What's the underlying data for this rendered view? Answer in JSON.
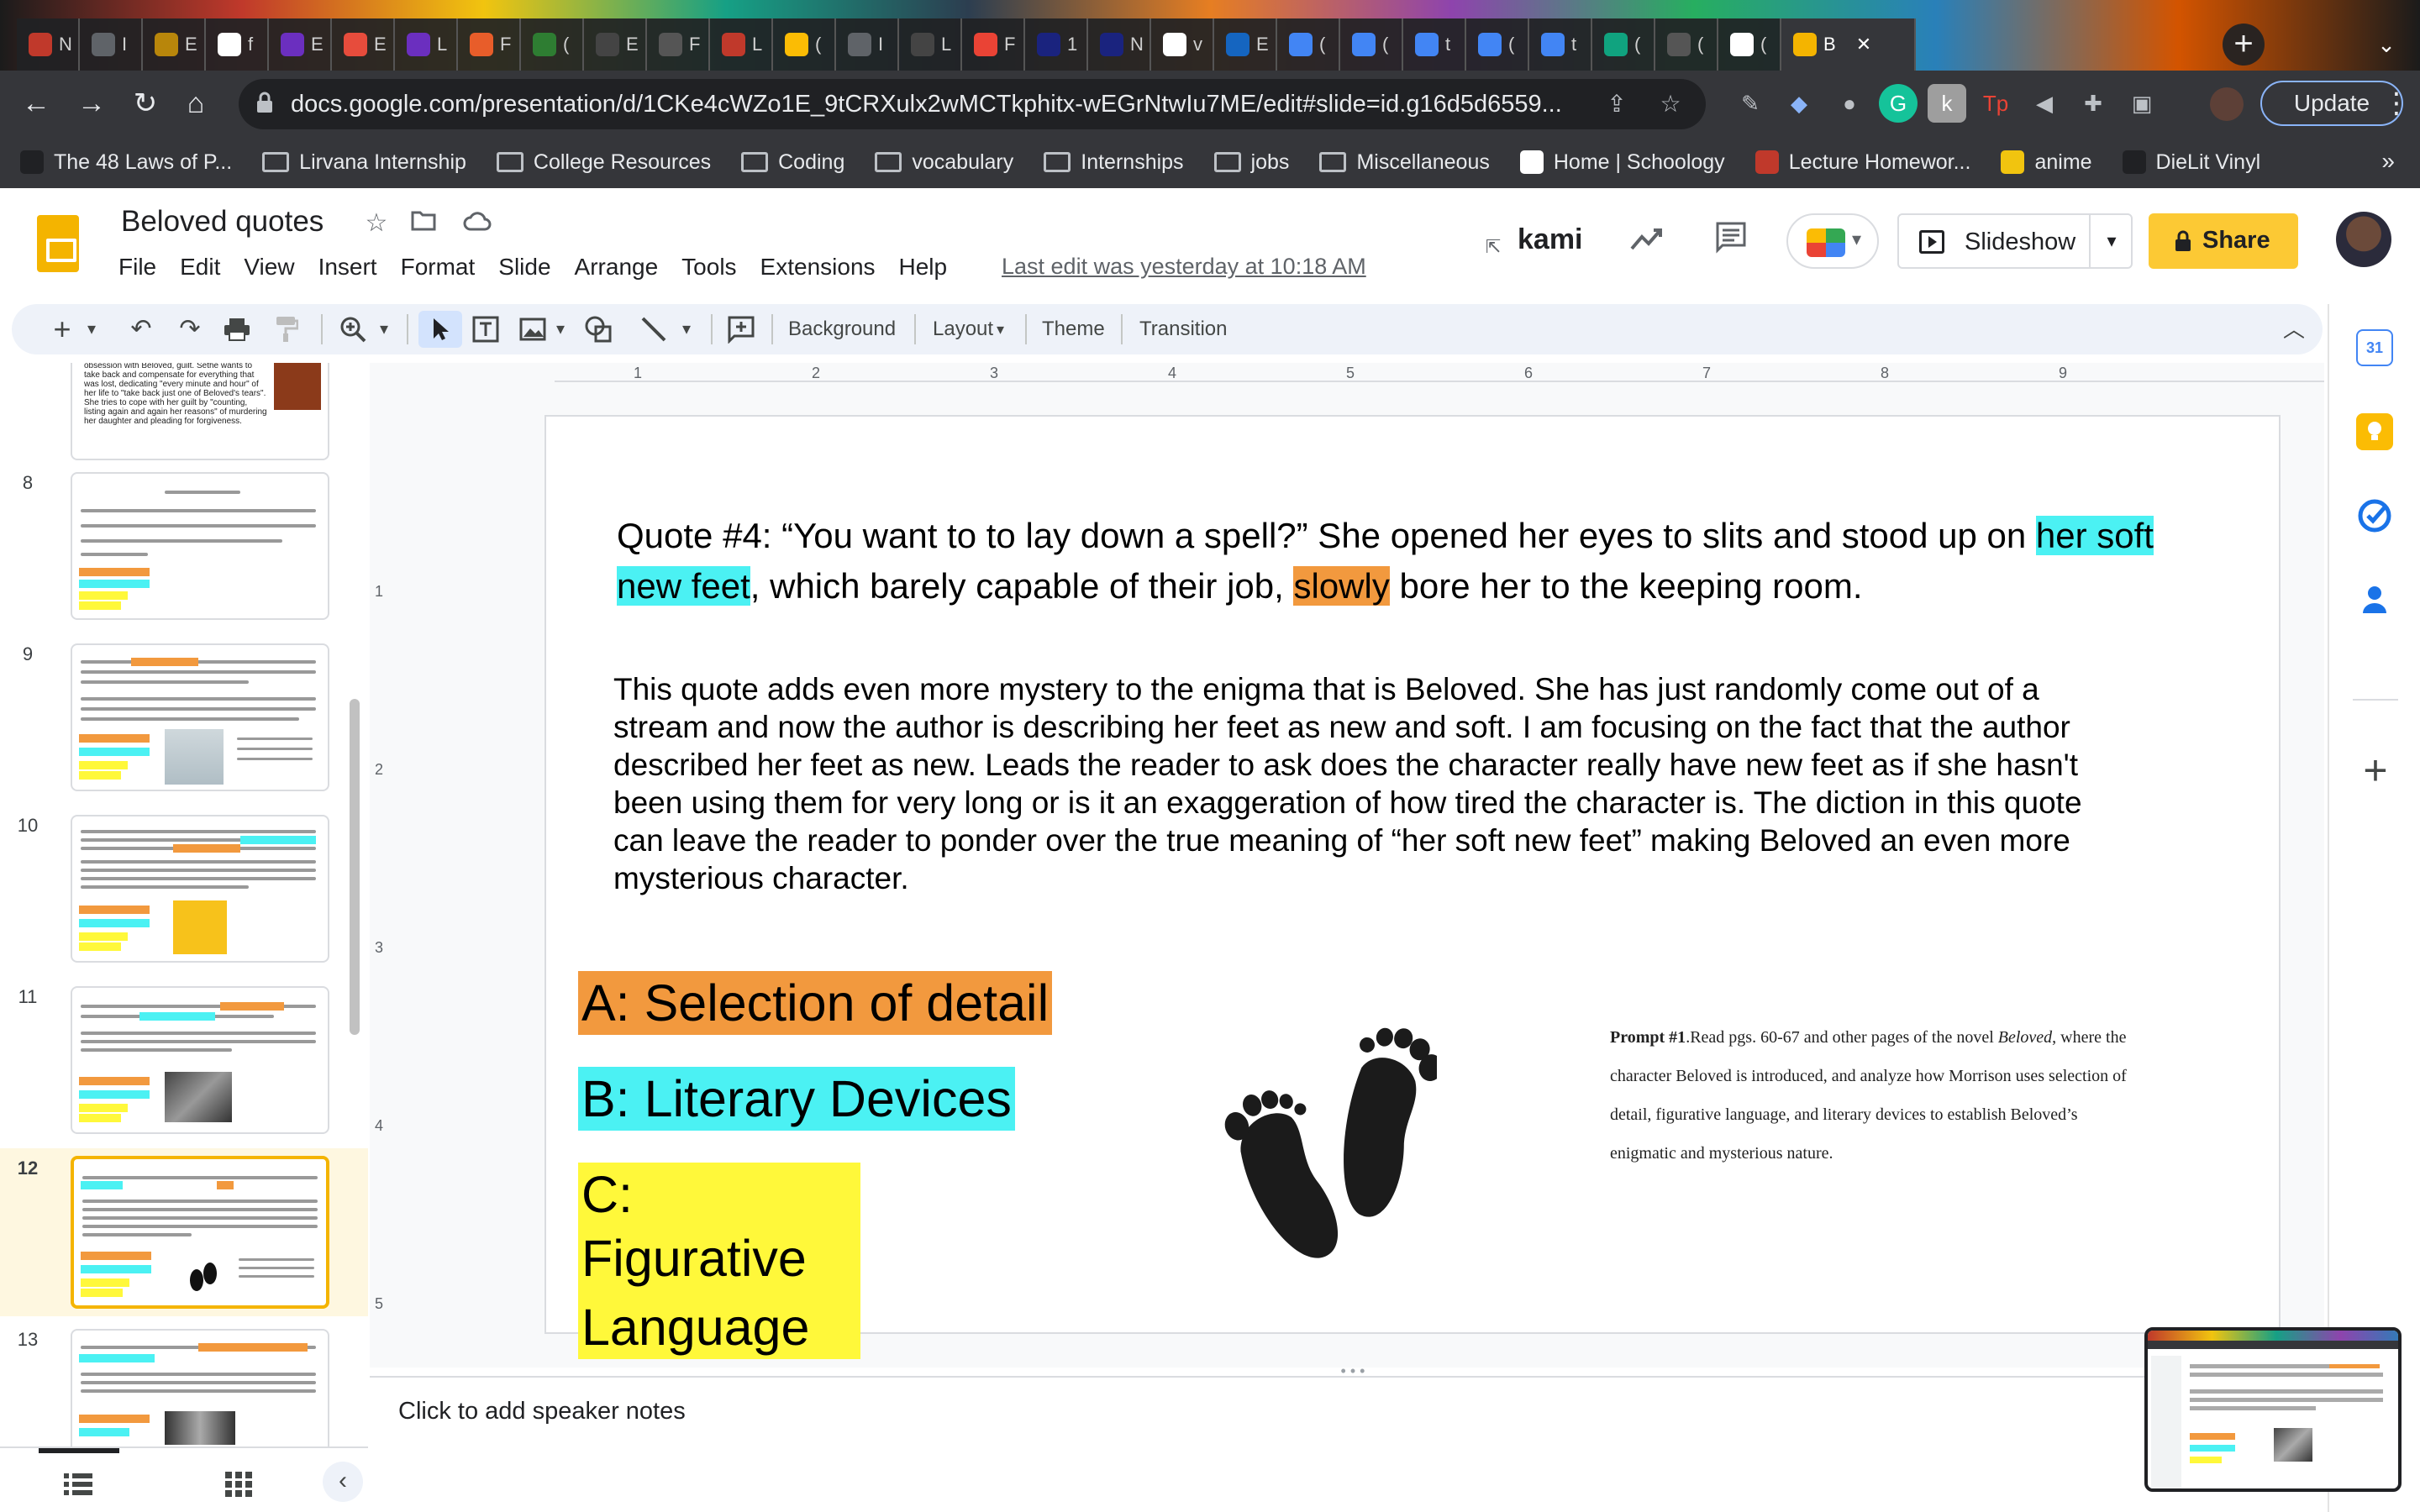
{
  "browser": {
    "tabs": [
      {
        "letter": "N",
        "icon": "generic-red-icon",
        "color": "#c0392b"
      },
      {
        "letter": "I",
        "icon": "globe-icon",
        "color": "#5f6368"
      },
      {
        "letter": "E",
        "icon": "iw-icon",
        "color": "#b8860b"
      },
      {
        "letter": "f",
        "icon": "google-icon",
        "color": "#ffffff"
      },
      {
        "letter": "E",
        "icon": "zb-icon",
        "color": "#6b2fbf"
      },
      {
        "letter": "E",
        "icon": "red-doc-icon",
        "color": "#e74c3c"
      },
      {
        "letter": "L",
        "icon": "zb-icon",
        "color": "#6b2fbf"
      },
      {
        "letter": "F",
        "icon": "asterisk-icon",
        "color": "#e85d2a"
      },
      {
        "letter": "(",
        "icon": "w-icon",
        "color": "#2e7d32"
      },
      {
        "letter": "E",
        "icon": "s-icon",
        "color": "#444444"
      },
      {
        "letter": "F",
        "icon": "feather-icon",
        "color": "#555555"
      },
      {
        "letter": "L",
        "icon": "dotted-circle-icon",
        "color": "#c0392b"
      },
      {
        "letter": "(",
        "icon": "drive-icon",
        "color": "#fbbc04"
      },
      {
        "letter": "I",
        "icon": "globe-icon",
        "color": "#5f6368"
      },
      {
        "letter": "L",
        "icon": "m-icon",
        "color": "#444444"
      },
      {
        "letter": "F",
        "icon": "gmail-icon",
        "color": "#ea4335"
      },
      {
        "letter": "1",
        "icon": "cal-icon",
        "color": "#1a237e"
      },
      {
        "letter": "N",
        "icon": "cal-icon",
        "color": "#1a237e"
      },
      {
        "letter": "v",
        "icon": "google-icon",
        "color": "#ffffff"
      },
      {
        "letter": "E",
        "icon": "asterisk-icon",
        "color": "#1565c0"
      },
      {
        "letter": "(",
        "icon": "docs-icon",
        "color": "#4285f4"
      },
      {
        "letter": "(",
        "icon": "docs-icon",
        "color": "#4285f4"
      },
      {
        "letter": "t",
        "icon": "docs-icon",
        "color": "#4285f4"
      },
      {
        "letter": "(",
        "icon": "docs-icon",
        "color": "#4285f4"
      },
      {
        "letter": "t",
        "icon": "docs-icon",
        "color": "#4285f4"
      },
      {
        "letter": "(",
        "icon": "chatgpt-icon",
        "color": "#10a37f"
      },
      {
        "letter": "(",
        "icon": "chatgpt-icon",
        "color": "#555555"
      },
      {
        "letter": "(",
        "icon": "google-icon",
        "color": "#ffffff"
      }
    ],
    "active_tab": {
      "letter": "B",
      "close": "✕",
      "color": "#f4b400"
    },
    "url": "docs.google.com/presentation/d/1CKe4cWZo1E_9tCRXulx2wMCTkphitx-wEGrNtwIu7ME/edit#slide=id.g16d5d6559...",
    "update_label": "Update",
    "bookmarks": [
      {
        "label": "The 48 Laws of P...",
        "type": "site",
        "color": "#202124"
      },
      {
        "label": "Lirvana Internship",
        "type": "folder"
      },
      {
        "label": "College Resources",
        "type": "folder"
      },
      {
        "label": "Coding",
        "type": "folder"
      },
      {
        "label": "vocabulary",
        "type": "folder"
      },
      {
        "label": "Internships",
        "type": "folder"
      },
      {
        "label": "jobs",
        "type": "folder"
      },
      {
        "label": "Miscellaneous",
        "type": "folder"
      },
      {
        "label": "Home | Schoology",
        "type": "site",
        "color": "#ffffff"
      },
      {
        "label": "Lecture Homewor...",
        "type": "site",
        "color": "#c0392b"
      },
      {
        "label": "anime",
        "type": "site",
        "color": "#f1c40f"
      },
      {
        "label": "DieLit Vinyl",
        "type": "site",
        "color": "#202124"
      }
    ],
    "bookmarks_more": "»"
  },
  "app": {
    "title": "Beloved quotes",
    "menu": [
      "File",
      "Edit",
      "View",
      "Insert",
      "Format",
      "Slide",
      "Arrange",
      "Tools",
      "Extensions",
      "Help"
    ],
    "last_edit": "Last edit was yesterday at 10:18 AM",
    "kami_label": "kami",
    "slideshow_label": "Slideshow",
    "share_label": "Share",
    "colors": {
      "accent": "#f4b400",
      "share": "#fcc934"
    }
  },
  "toolbar": {
    "background_label": "Background",
    "layout_label": "Layout",
    "theme_label": "Theme",
    "transition_label": "Transition"
  },
  "ruler": {
    "h_ticks": [
      "1",
      "2",
      "3",
      "4",
      "5",
      "6",
      "7",
      "8",
      "9"
    ],
    "v_ticks": [
      "1",
      "2",
      "3",
      "4",
      "5"
    ]
  },
  "filmstrip": {
    "slide_numbers": [
      "8",
      "9",
      "10",
      "11",
      "12",
      "13"
    ],
    "selected": "12",
    "slide_7_text": "obsession with Beloved, guilt. Sethe wants to take back and compensate for everything that was lost, dedicating \"every minute and hour\" of her life to \"take back just one of Beloved's tears\". She tries to cope with her guilt by \"counting, listing again and again her reasons\" of murdering her daughter and pleading for forgiveness."
  },
  "slide": {
    "quote_prefix": "Quote #4: “You want to to lay down a spell?” She opened her eyes to slits and stood up on ",
    "quote_highlight_1": "her soft new feet",
    "quote_middle": ", which barely capable of their job, ",
    "quote_highlight_2": "slowly",
    "quote_suffix": " bore her to the keeping room.",
    "analysis": "This quote adds even more mystery to the enigma that is Beloved. She has just randomly come out of a stream and now the author is describing her feet as new and soft. I am focusing on the fact that the author described her feet as new. Leads the reader to ask does the character really have new feet as if she hasn't been using them for very long or is it an exaggeration of how tired the character is. The diction in this quote can leave the reader to ponder over the true meaning of “her soft new feet” making Beloved an even more mysterious character.",
    "label_a": "A: Selection of detail",
    "label_b": "B: Literary Devices",
    "label_c_line1": "C: Figurative",
    "label_c_line2": "Language",
    "prompt_bold": "Prompt #1",
    "prompt_part1": ".Read pgs. 60-67 and other pages of the novel ",
    "prompt_italic": "Beloved",
    "prompt_part2": ", where the character Beloved is introduced, and analyze how Morrison uses selection of detail, figurative language, and literary devices to establish Beloved’s enigmatic and mysterious nature.",
    "colors": {
      "orange": "#f2993e",
      "cyan": "#4bf1f3",
      "yellow": "#fff83a"
    }
  },
  "notes": {
    "placeholder": "Click to add speaker notes"
  }
}
